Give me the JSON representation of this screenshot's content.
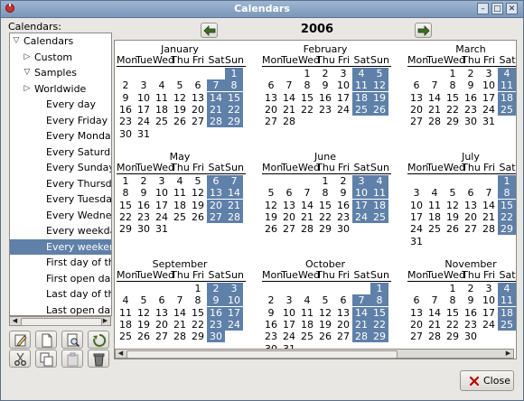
{
  "window": {
    "title": "Calendars"
  },
  "sidebar": {
    "label": "Calendars:",
    "tree": [
      {
        "label": "Calendars",
        "arrow": "▽",
        "indent": 0
      },
      {
        "label": "Custom",
        "arrow": "▷",
        "indent": 1
      },
      {
        "label": "Samples",
        "arrow": "▽",
        "indent": 1
      },
      {
        "label": "Worldwide",
        "arrow": "▷",
        "indent": 2
      },
      {
        "label": "Every day",
        "indent": 3
      },
      {
        "label": "Every Friday",
        "indent": 3
      },
      {
        "label": "Every Monday",
        "indent": 3
      },
      {
        "label": "Every Saturday",
        "indent": 3
      },
      {
        "label": "Every Sunday",
        "indent": 3
      },
      {
        "label": "Every Thursday",
        "indent": 3
      },
      {
        "label": "Every Tuesday",
        "indent": 3
      },
      {
        "label": "Every Wednesday",
        "indent": 3
      },
      {
        "label": "Every weekday",
        "indent": 3
      },
      {
        "label": "Every weekend",
        "indent": 3,
        "selected": true
      },
      {
        "label": "First day of the month",
        "indent": 3
      },
      {
        "label": "First open day of the month",
        "indent": 3
      },
      {
        "label": "Last day of the month",
        "indent": 3
      },
      {
        "label": "Last open day of the month",
        "indent": 3
      }
    ]
  },
  "toolbar": {
    "row1": [
      "edit-icon",
      "new-document-icon",
      "preview-icon",
      "refresh-icon"
    ],
    "row2": [
      "cut-icon",
      "copy-icon",
      "paste-icon",
      "delete-icon"
    ]
  },
  "nav": {
    "year": "2006"
  },
  "calendar": {
    "weekday_headers": [
      "Mon",
      "Tue",
      "Wed",
      "Thu",
      "Fri",
      "Sat",
      "Sun"
    ],
    "months": [
      {
        "name": "January",
        "start": 6,
        "days": 31
      },
      {
        "name": "February",
        "start": 2,
        "days": 28
      },
      {
        "name": "March",
        "start": 2,
        "days": 31
      },
      {
        "name": "May",
        "start": 0,
        "days": 31
      },
      {
        "name": "June",
        "start": 3,
        "days": 30
      },
      {
        "name": "July",
        "start": 5,
        "days": 31
      },
      {
        "name": "September",
        "start": 4,
        "days": 30
      },
      {
        "name": "October",
        "start": 6,
        "days": 31
      },
      {
        "name": "November",
        "start": 2,
        "days": 30
      }
    ],
    "highlight_color": "#5f80a8"
  },
  "footer": {
    "close_label": "Close"
  }
}
